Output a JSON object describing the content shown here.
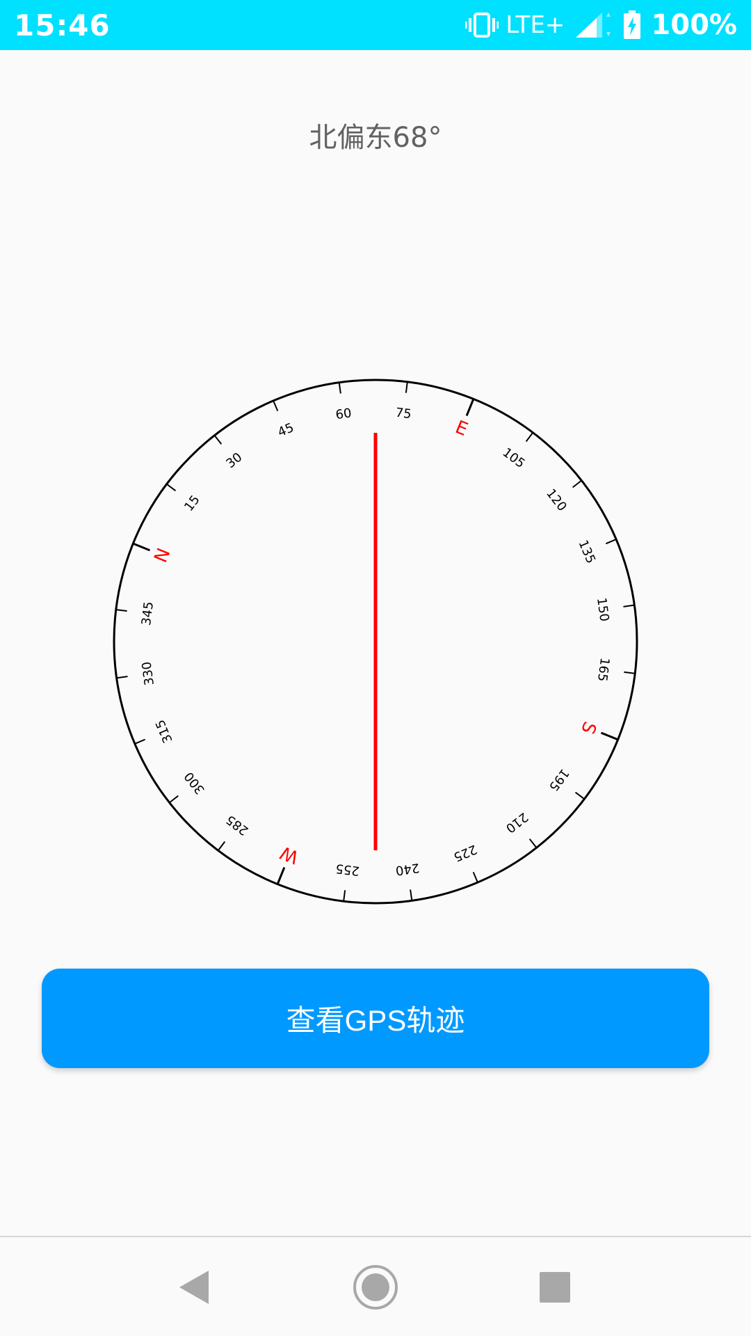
{
  "status_bar": {
    "time": "15:46",
    "network": "LTE+",
    "battery": "100%",
    "icons": [
      "vibrate-icon",
      "signal-icon",
      "battery-charging-icon"
    ],
    "background_color": "#00e0ff"
  },
  "heading": {
    "direction_text": "北偏东68°"
  },
  "compass": {
    "heading_degrees": 68,
    "degree_labels": [
      "15",
      "30",
      "45",
      "60",
      "75",
      "105",
      "120",
      "135",
      "150",
      "165",
      "195",
      "210",
      "225",
      "240",
      "255",
      "285",
      "300",
      "315",
      "330",
      "345"
    ],
    "cardinal_labels": [
      "N",
      "E",
      "S",
      "W"
    ],
    "cardinal_color": "#ff0000",
    "needle_color": "#ff0000",
    "ring_color": "#000000"
  },
  "button": {
    "label": "查看GPS轨迹",
    "color": "#0099ff"
  },
  "nav_bar": {
    "icons": [
      "back-icon",
      "home-icon",
      "recents-icon"
    ]
  }
}
